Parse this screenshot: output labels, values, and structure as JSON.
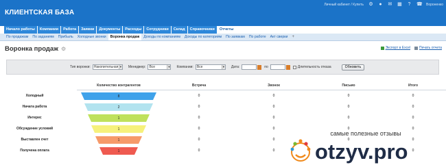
{
  "app": {
    "title": "КЛИЕНТСКАЯ БАЗА"
  },
  "topright": {
    "cabinet_link": "Личный кабинет / Купить",
    "user": "Вороненко"
  },
  "nav_main": [
    "Начало работы",
    "Компании",
    "Работа",
    "Заявки",
    "Документы",
    "Расходы",
    "Сотрудники",
    "Склад",
    "Справочники",
    "Отчеты"
  ],
  "nav_main_active": "Отчеты",
  "nav_main_plus": "+",
  "nav_sub": [
    "По продажам",
    "По заданиям",
    "Прибыль",
    "Холодные звонки",
    "Воронка продаж",
    "Доходы по компаниям",
    "Доходы по категориям",
    "По заявкам",
    "По работе",
    "Акт сверки"
  ],
  "nav_sub_active": "Воронка продаж",
  "nav_sub_plus": "+",
  "page": {
    "title": "Воронка продаж",
    "export_excel": "Экспорт в Excel",
    "print": "Печать отчета"
  },
  "filters": {
    "funnel_type_label": "Тип воронки:",
    "funnel_type_value": "Накопительная",
    "manager_label": "Менеджер:",
    "manager_value": "Все",
    "company_label": "Компании:",
    "company_value": "Все",
    "date_label": "Дата:",
    "date_to_label": "по",
    "duration_label": "Длительность отказа",
    "refresh_button": "Обновить"
  },
  "table": {
    "headers": [
      "Количество контрагентов",
      "Встреча",
      "Звонок",
      "Письмо",
      "Итого"
    ],
    "rows": [
      {
        "stage": "Холодный",
        "count": "8",
        "cells": [
          "0",
          "0",
          "0",
          "0"
        ],
        "color": "#3fa2ea"
      },
      {
        "stage": "Начата работа",
        "count": "2",
        "cells": [
          "0",
          "0",
          "0",
          "0"
        ],
        "color": "#b2e3ef"
      },
      {
        "stage": "Интерес",
        "count": "1",
        "cells": [
          "0",
          "0",
          "0",
          "0"
        ],
        "color": "#bfe15c"
      },
      {
        "stage": "Обсуждение условий",
        "count": "1",
        "cells": [
          "0",
          "0",
          "0",
          "0"
        ],
        "color": "#f6f17c"
      },
      {
        "stage": "Выставлен счет",
        "count": "1",
        "cells": [
          "0",
          "0",
          "0",
          "0"
        ],
        "color": "#f69a6a"
      },
      {
        "stage": "Получена оплата",
        "count": "1",
        "cells": [
          "0",
          "0",
          "0",
          "0"
        ],
        "color": "#ef5a50"
      }
    ]
  },
  "watermark": {
    "tagline": "самые полезные отзывы",
    "brand": "otzyv.pro"
  }
}
